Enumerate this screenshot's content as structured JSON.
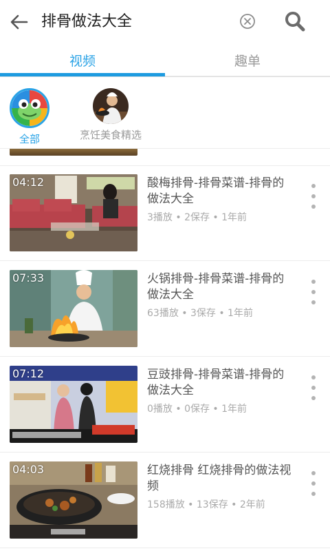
{
  "search": {
    "query": "排骨做法大全",
    "back_icon": "arrow-left-icon",
    "clear_icon": "clear-circle-icon",
    "search_icon": "magnifier-icon"
  },
  "tabs": [
    {
      "label": "视频",
      "active": true
    },
    {
      "label": "趣单",
      "active": false
    }
  ],
  "filters": [
    {
      "label": "全部",
      "selected": true
    },
    {
      "label": "烹饪美食精选",
      "selected": false
    }
  ],
  "videos": [
    {
      "duration": "04:12",
      "title": "酸梅排骨-排骨菜谱-排骨的做法大全",
      "meta": "3播放 • 2保存 • 1年前"
    },
    {
      "duration": "07:33",
      "title": "火锅排骨-排骨菜谱-排骨的做法大全",
      "meta": "63播放 • 3保存 • 1年前"
    },
    {
      "duration": "07:12",
      "title": "豆豉排骨-排骨菜谱-排骨的做法大全",
      "meta": "0播放 • 0保存 • 1年前"
    },
    {
      "duration": "04:03",
      "title": "红烧排骨 红烧排骨的做法视频",
      "meta": "158播放 • 13保存 • 2年前"
    }
  ],
  "colors": {
    "accent": "#1e9be0",
    "tab_active_text": "#2aa3e6",
    "muted": "#9a9a9a"
  }
}
